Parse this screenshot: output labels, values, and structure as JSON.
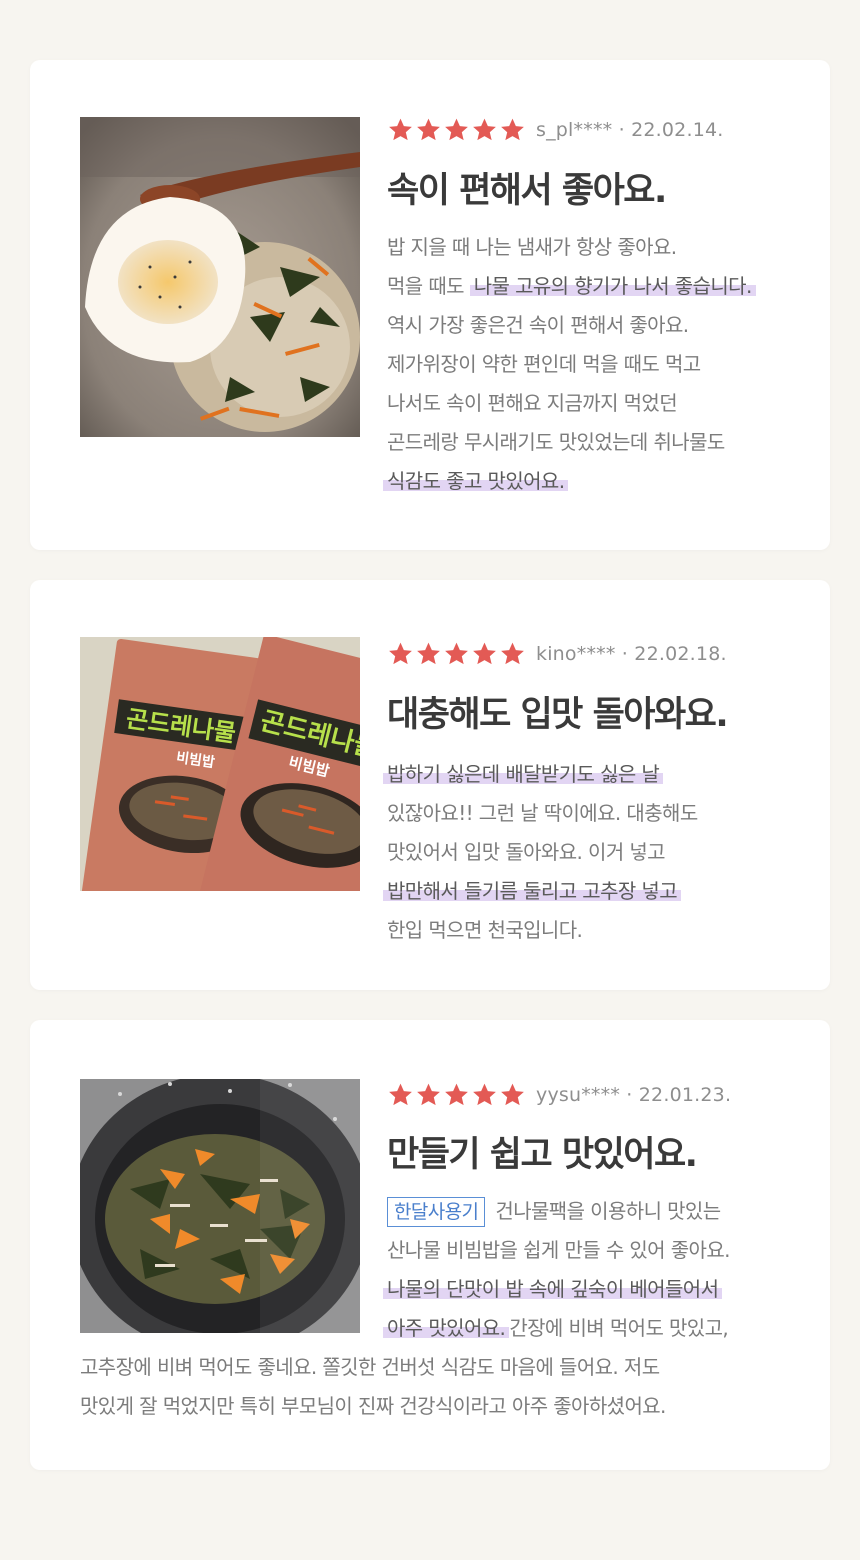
{
  "colors": {
    "background": "#f7f5f0",
    "card": "#ffffff",
    "star": "#e35a55",
    "highlight": "#e2d5f3",
    "tag_border": "#5a8fd6"
  },
  "star_icon": "star-icon",
  "reviews": [
    {
      "rating": 5,
      "user": "s_pl****",
      "date": "22.02.14.",
      "title": "속이 편해서 좋아요.",
      "photo": "bibimbap-with-fried-egg",
      "lines": [
        [
          "밥 지을 때 나는 냄새가 항상 좋아요."
        ],
        [
          "먹을 때도 ",
          "나물 고유의 향기가 나서 좋습니다."
        ],
        [
          "역시 가장 좋은건 속이 편해서 좋아요."
        ],
        [
          "제가위장이 약한 편인데 먹을 때도 먹고"
        ],
        [
          "나서도 속이 편해요 지금까지 먹었던"
        ],
        [
          "곤드레랑 무시래기도 맛있었는데 취나물도"
        ],
        [
          "",
          "식감도 좋고 맛있어요."
        ]
      ]
    },
    {
      "rating": 5,
      "user": "kino****",
      "date": "22.02.18.",
      "title": "대충해도 입맛 돌아와요.",
      "photo": "product-packages",
      "package_text": "곤드레나물",
      "package_sub": "비빔밥",
      "lines": [
        [
          "",
          "밥하기 싫은데 배달받기도 싫은 날"
        ],
        [
          "있잖아요!! 그런 날 딱이에요. 대충해도"
        ],
        [
          "맛있어서 입맛 돌아와요. 이거 넣고"
        ],
        [
          "",
          "밥만해서 들기름 둘리고 고추장 넣고"
        ],
        [
          "한입 먹으면 천국입니다."
        ]
      ]
    },
    {
      "rating": 5,
      "user": "yysu****",
      "date": "22.01.23.",
      "title": "만들기 쉽고 맛있어요.",
      "photo": "rice-cooker-bibimbap",
      "tag": "한달사용기",
      "lines": [
        [
          "건나물팩을 이용하니 맛있는"
        ],
        [
          "산나물 비빔밥을 쉽게 만들 수 있어 좋아요."
        ],
        [
          "",
          "나물의 단맛이 밥 속에 깊숙이 베어들어서"
        ],
        [
          "",
          "아주 맛있어요.",
          "간장에 비벼 먹어도 맛있고,"
        ]
      ],
      "wide_lines": [
        "고추장에 비벼 먹어도 좋네요. 쫄깃한 건버섯 식감도 마음에 들어요. 저도",
        "맛있게 잘 먹었지만 특히 부모님이 진짜 건강식이라고 아주 좋아하셨어요."
      ]
    }
  ]
}
